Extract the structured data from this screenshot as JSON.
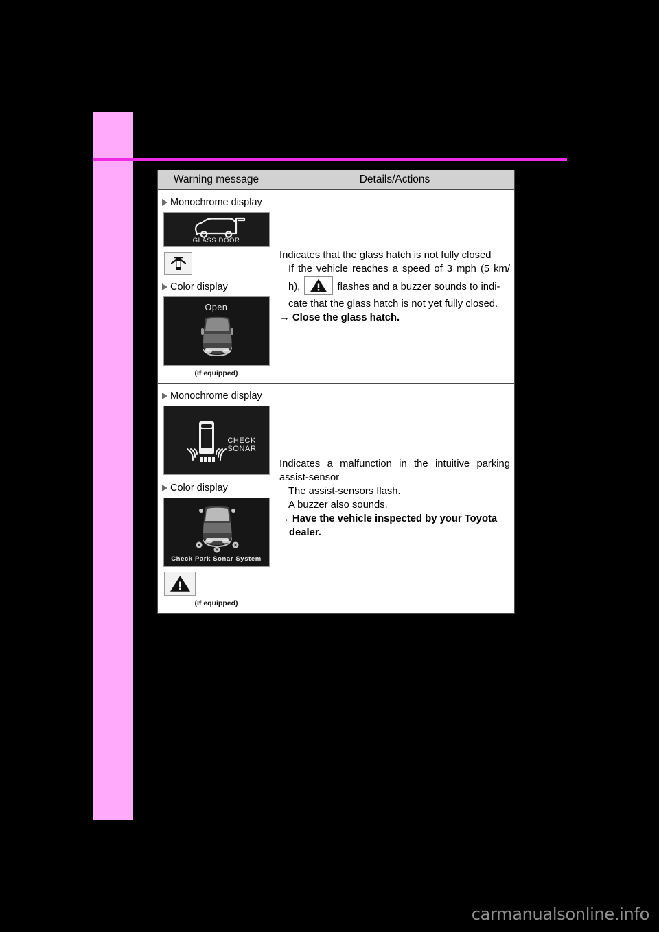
{
  "page": {
    "accent_color": "#EE2BE4",
    "side_tab_color": "#FFAAFB",
    "watermark": "carmanualsonline.info"
  },
  "table": {
    "headers": {
      "warning_message": "Warning message",
      "details_actions": "Details/Actions"
    },
    "rows": [
      {
        "id": "glass-hatch",
        "mono_label": "Monochrome display",
        "mono_screen_text": "GLASS DOOR",
        "mono_icon_name": "door-ajar-icon",
        "color_label": "Color display",
        "color_screen_text": "Open",
        "caption": "(If equipped)",
        "details": {
          "line1": "Indicates that the glass hatch is not fully closed",
          "line2": "If the vehicle reaches a speed of 3 mph (5 km/",
          "line3_pre": "h),",
          "line3_icon": "warning-triangle-icon",
          "line3_post": "flashes and a buzzer sounds to indi-",
          "line4": "cate that the glass hatch is not yet fully closed.",
          "action_arrow": "→",
          "action": "Close the glass hatch."
        }
      },
      {
        "id": "park-sonar",
        "mono_label": "Monochrome display",
        "mono_screen_text": "CHECK\nSONAR",
        "color_label": "Color display",
        "color_screen_text": "Check Park Sonar System",
        "color_icon_name": "warning-triangle-icon",
        "caption": "(If equipped)",
        "details": {
          "line1": "Indicates a malfunction in the intuitive parking",
          "line2": "assist-sensor",
          "line3": "The assist-sensors flash.",
          "line4": "A buzzer also sounds.",
          "action_arrow": "→",
          "action": "Have the vehicle inspected by your Toyota dealer."
        }
      }
    ]
  }
}
